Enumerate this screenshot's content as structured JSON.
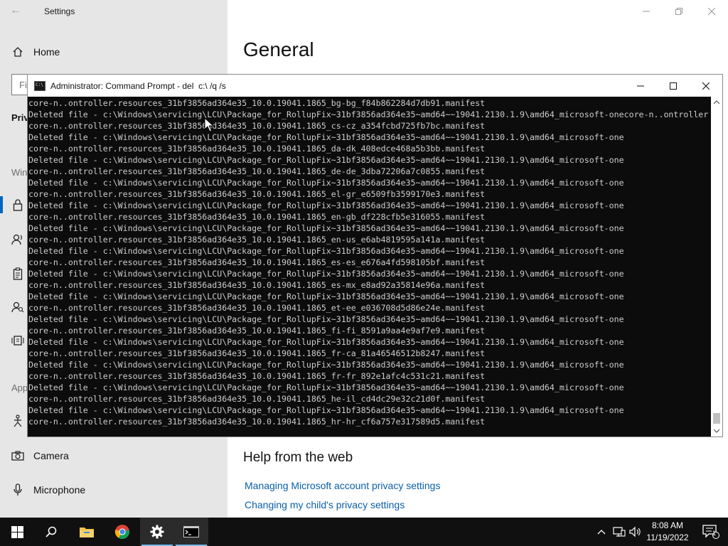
{
  "settings": {
    "title": "Settings",
    "search_placeholder": "Fi",
    "nav": {
      "home": "Home",
      "privacy_trunc": "Priv",
      "windows_section_trunc": "Win",
      "app_section_trunc": "App",
      "camera": "Camera",
      "microphone": "Microphone"
    },
    "page_heading": "General",
    "help_heading": "Help from the web",
    "help_links": [
      "Managing Microsoft account privacy settings",
      "Changing my child's privacy settings"
    ]
  },
  "cmd": {
    "title": "Administrator: Command Prompt - del  c:\\ /q /s",
    "lines": [
      "core-n..ontroller.resources_31bf3856ad364e35_10.0.19041.1865_bg-bg_f84b862284d7db91.manifest",
      "Deleted file - c:\\Windows\\servicing\\LCU\\Package_for_RollupFix~31bf3856ad364e35~amd64~~19041.2130.1.9\\amd64_microsoft-onecore-n..ontroller.resources_31bf3856ad364e35_10.0.19041.1865_cs-cz_a354fcbd725fb7bc.manifest",
      "core-n..ontroller.resources_31bf3856ad364e35_10.0.19041.1865_cs-cz_a354fcbd725fb7bc.manifest",
      "Deleted file - c:\\Windows\\servicing\\LCU\\Package_for_RollupFix~31bf3856ad364e35~amd64~~19041.2130.1.9\\amd64_microsoft-one",
      "core-n..ontroller.resources_31bf3856ad364e35_10.0.19041.1865_da-dk_408edce468a5b3bb.manifest",
      "Deleted file - c:\\Windows\\servicing\\LCU\\Package_for_RollupFix~31bf3856ad364e35~amd64~~19041.2130.1.9\\amd64_microsoft-one",
      "core-n..ontroller.resources_31bf3856ad364e35_10.0.19041.1865_de-de_3dba72206a7c0855.manifest",
      "Deleted file - c:\\Windows\\servicing\\LCU\\Package_for_RollupFix~31bf3856ad364e35~amd64~~19041.2130.1.9\\amd64_microsoft-one",
      "core-n..ontroller.resources_31bf3856ad364e35_10.0.19041.1865_el-gr_e6509fb3599170e3.manifest",
      "Deleted file - c:\\Windows\\servicing\\LCU\\Package_for_RollupFix~31bf3856ad364e35~amd64~~19041.2130.1.9\\amd64_microsoft-one",
      "core-n..ontroller.resources_31bf3856ad364e35_10.0.19041.1865_en-gb_df228cfb5e316055.manifest",
      "Deleted file - c:\\Windows\\servicing\\LCU\\Package_for_RollupFix~31bf3856ad364e35~amd64~~19041.2130.1.9\\amd64_microsoft-one",
      "core-n..ontroller.resources_31bf3856ad364e35_10.0.19041.1865_en-us_e6ab4819595a141a.manifest",
      "Deleted file - c:\\Windows\\servicing\\LCU\\Package_for_RollupFix~31bf3856ad364e35~amd64~~19041.2130.1.9\\amd64_microsoft-one",
      "core-n..ontroller.resources_31bf3856ad364e35_10.0.19041.1865_es-es_e676a4fd598105bf.manifest",
      "Deleted file - c:\\Windows\\servicing\\LCU\\Package_for_RollupFix~31bf3856ad364e35~amd64~~19041.2130.1.9\\amd64_microsoft-one",
      "core-n..ontroller.resources_31bf3856ad364e35_10.0.19041.1865_es-mx_e8ad92a35814e96a.manifest",
      "Deleted file - c:\\Windows\\servicing\\LCU\\Package_for_RollupFix~31bf3856ad364e35~amd64~~19041.2130.1.9\\amd64_microsoft-one",
      "core-n..ontroller.resources_31bf3856ad364e35_10.0.19041.1865_et-ee_e036708d5d86e24e.manifest",
      "Deleted file - c:\\Windows\\servicing\\LCU\\Package_for_RollupFix~31bf3856ad364e35~amd64~~19041.2130.1.9\\amd64_microsoft-one",
      "core-n..ontroller.resources_31bf3856ad364e35_10.0.19041.1865_fi-fi_8591a9aa4e9af7e9.manifest",
      "Deleted file - c:\\Windows\\servicing\\LCU\\Package_for_RollupFix~31bf3856ad364e35~amd64~~19041.2130.1.9\\amd64_microsoft-one",
      "core-n..ontroller.resources_31bf3856ad364e35_10.0.19041.1865_fr-ca_81a46546512b8247.manifest",
      "Deleted file - c:\\Windows\\servicing\\LCU\\Package_for_RollupFix~31bf3856ad364e35~amd64~~19041.2130.1.9\\amd64_microsoft-one",
      "core-n..ontroller.resources_31bf3856ad364e35_10.0.19041.1865_fr-fr_892e1afc4c531c21.manifest",
      "Deleted file - c:\\Windows\\servicing\\LCU\\Package_for_RollupFix~31bf3856ad364e35~amd64~~19041.2130.1.9\\amd64_microsoft-one",
      "core-n..ontroller.resources_31bf3856ad364e35_10.0.19041.1865_he-il_cd4dc29e32c21d0f.manifest",
      "Deleted file - c:\\Windows\\servicing\\LCU\\Package_for_RollupFix~31bf3856ad364e35~amd64~~19041.2130.1.9\\amd64_microsoft-one",
      "core-n..ontroller.resources_31bf3856ad364e35_10.0.19041.1865_hr-hr_cf6a757e317589d5.manifest"
    ]
  },
  "taskbar": {
    "time": "8:08 AM",
    "date": "11/19/2022",
    "notification_count": "1",
    "pinned": [
      "start-icon",
      "search-icon",
      "file-explorer-icon",
      "chrome-icon",
      "settings-icon",
      "command-prompt-icon"
    ]
  },
  "colors": {
    "accent": "#0067c0",
    "link": "#0a5fa8",
    "console_bg": "#0c0c0c",
    "console_fg": "#cccccc",
    "taskbar": "#101010"
  }
}
